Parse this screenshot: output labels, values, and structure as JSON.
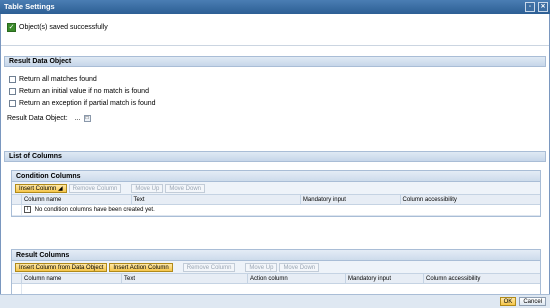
{
  "window": {
    "title": "Table Settings"
  },
  "message": {
    "text": "Object(s) saved successfully"
  },
  "result_data_object": {
    "heading": "Result Data Object",
    "options": [
      "Return all matches found",
      "Return an initial value if no match is found",
      "Return an exception if partial match is found"
    ],
    "field_label": "Result Data Object:",
    "field_value": "..."
  },
  "list_of_columns": {
    "heading": "List of Columns"
  },
  "condition_columns": {
    "heading": "Condition Columns",
    "buttons": {
      "insert": "Insert Column",
      "remove": "Remove Column",
      "move_up": "Move Up",
      "move_down": "Move Down"
    },
    "columns": [
      "Column name",
      "Text",
      "Mandatory input",
      "Column accessibility"
    ],
    "empty_text": "No condition columns have been created yet."
  },
  "result_columns": {
    "heading": "Result Columns",
    "buttons": {
      "insert_from_data_object": "Insert Column from Data Object",
      "insert_action": "Insert Action Column",
      "remove": "Remove Column",
      "move_up": "Move Up",
      "move_down": "Move Down"
    },
    "columns": [
      "Column name",
      "Text",
      "Action column",
      "Mandatory input",
      "Column accessibility"
    ]
  },
  "footer": {
    "ok": "OK",
    "cancel": "Cancel"
  }
}
